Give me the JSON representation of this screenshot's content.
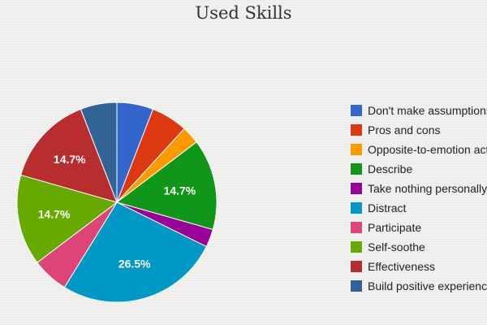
{
  "chart_data": {
    "type": "pie",
    "title": "Used Skills",
    "categories": [
      "Don't make assumptions",
      "Pros and cons",
      "Opposite-to-emotion action",
      "Describe",
      "Take nothing personally",
      "Distract",
      "Participate",
      "Self-soothe",
      "Effectiveness",
      "Build positive experiences"
    ],
    "values": [
      5.9,
      5.9,
      2.9,
      14.7,
      2.9,
      26.5,
      5.9,
      14.7,
      14.7,
      5.9
    ],
    "unit": "%",
    "slice_labels": [
      "",
      "",
      "",
      "14.7%",
      "",
      "26.5%",
      "",
      "14.7%",
      "14.7%",
      ""
    ],
    "colors": [
      "#3366cc",
      "#dc3912",
      "#ff9900",
      "#109618",
      "#990099",
      "#0099c6",
      "#dd4477",
      "#66aa00",
      "#b82e2e",
      "#316395"
    ],
    "legend_position": "right"
  }
}
